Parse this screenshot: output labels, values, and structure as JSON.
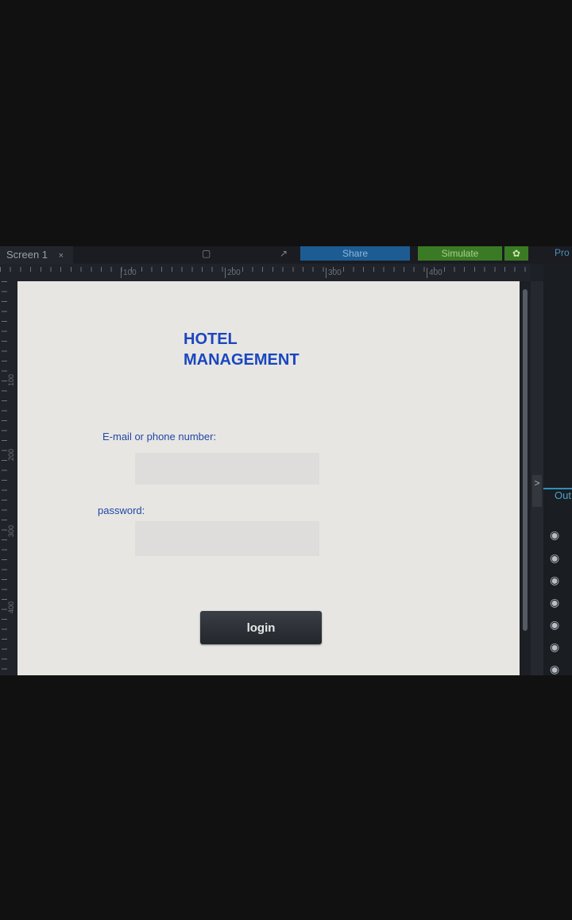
{
  "topbar": {
    "tab_label": "Screen 1",
    "tab_close": "×",
    "share_label": "Share",
    "simulate_label": "Simulate",
    "gear_icon": "gear-icon",
    "right_panel_label": "Pro"
  },
  "ruler": {
    "h_labels": [
      "100",
      "200",
      "300",
      "400"
    ],
    "v_labels": [
      "100",
      "200",
      "300",
      "400"
    ]
  },
  "form": {
    "title_line1": "HOTEL",
    "title_line2": "MANAGEMENT",
    "email_label": "E-mail or phone number:",
    "email_value": "",
    "password_label": "password:",
    "password_value": "",
    "login_label": "login"
  },
  "side_panel": {
    "collapse_arrow": ">",
    "outline_label": "Out",
    "eye_icon": "eye-icon"
  },
  "colors": {
    "title": "#1b46c0",
    "labels": "#2447a8",
    "share_button": "#1d5c93",
    "simulate_button": "#3a7a24",
    "canvas": "#e7e6e2"
  }
}
